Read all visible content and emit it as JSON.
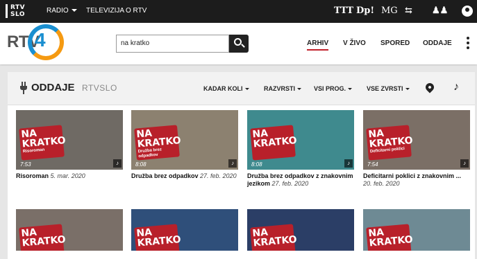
{
  "topbar": {
    "logo_line1": "RTV",
    "logo_line2": "SLO",
    "radio": "RADIO",
    "televizija": "TELEVIZIJA",
    "o_rtv": "O RTV",
    "channels": [
      "TTT",
      "Dp!",
      "MG"
    ]
  },
  "header": {
    "brand_text": "RTV",
    "brand_number": "4",
    "search_value": "na kratko",
    "nav": [
      "ARHIV",
      "V ŽIVO",
      "SPORED",
      "ODDAJE"
    ]
  },
  "filterbar": {
    "title": "ODDAJE",
    "subtitle": "RTVSLO",
    "filters": [
      "KADAR KOLI",
      "RAZVRSTI",
      "VSI PROG.",
      "VSE ZVRSTI"
    ]
  },
  "badge_text": "NA KRATKO",
  "cards": [
    {
      "title": "Risoroman",
      "date": "5. mar. 2020",
      "duration": "7:53",
      "subtitle": "Risoroman",
      "thumb_color": "#6f6a64"
    },
    {
      "title": "Družba brez odpadkov",
      "date": "27. feb. 2020",
      "duration": "8:08",
      "subtitle": "Družba brez odpadkov",
      "thumb_color": "#8c8170"
    },
    {
      "title": "Družba brez odpadkov z znakovnim jezikom",
      "date": "27. feb. 2020",
      "duration": "8:08",
      "subtitle": "",
      "thumb_color": "#3f8a8e"
    },
    {
      "title": "Deficitarni poklici z znakovnim ...",
      "date": "20. feb. 2020",
      "duration": "7:54",
      "subtitle": "Deficitarni poklici",
      "thumb_color": "#7b6f66"
    }
  ],
  "row2": [
    {
      "thumb_color": "#7a6f68"
    },
    {
      "thumb_color": "#2f4f7a"
    },
    {
      "thumb_color": "#2b3e66"
    },
    {
      "thumb_color": "#6e8a94"
    }
  ],
  "colors": {
    "accent": "#b8202a",
    "topbar": "#1c1c1c",
    "rtv4_blue": "#1a8fd0",
    "rtv4_orange": "#f59a12"
  }
}
